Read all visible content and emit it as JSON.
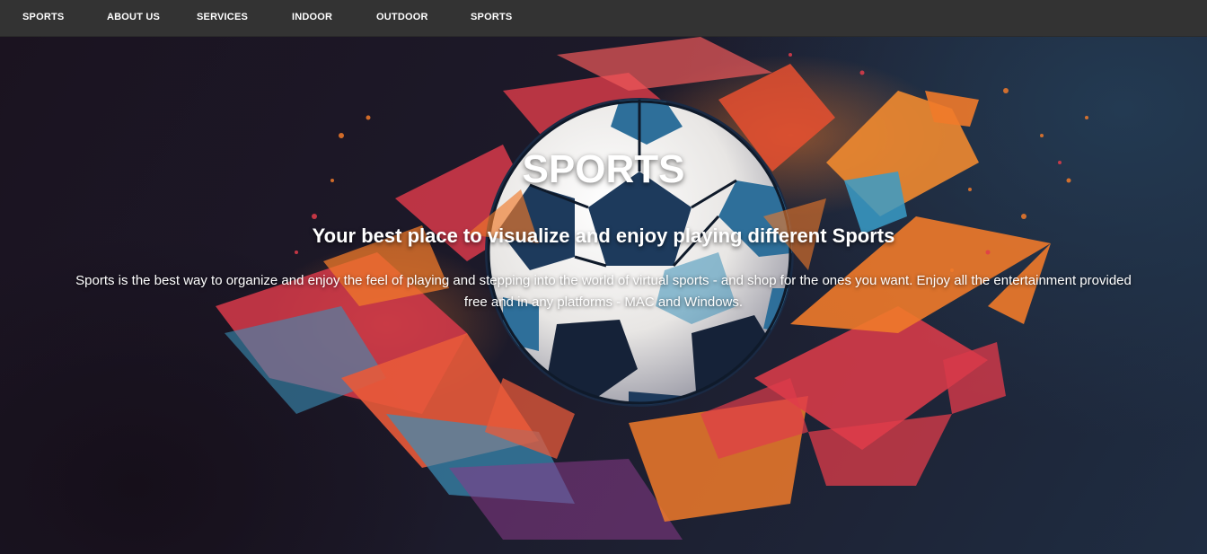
{
  "nav": {
    "items": [
      {
        "label": "SPORTS"
      },
      {
        "label": "ABOUT US"
      },
      {
        "label": "SERVICES"
      },
      {
        "label": "INDOOR"
      },
      {
        "label": "OUTDOOR"
      },
      {
        "label": "SPORTS"
      }
    ],
    "background": "#333333",
    "text_color": "#ffffff"
  },
  "hero": {
    "title": "SPORTS",
    "subtitle": "Your best place to visualize and enjoy playing different Sports",
    "description": "Sports is the best way to organize and enjoy the feel of playing and stepping into the world of virtual sports - and shop for the ones you want. Enjoy all the entertainment provided free and in any platforms - MAC and Windows.",
    "image": "soccer-ball-splash-illustration",
    "colors": {
      "orange": "#f07a2a",
      "red": "#e03c4a",
      "blue": "#3a8fb8",
      "background": "#1c1a2a"
    }
  }
}
